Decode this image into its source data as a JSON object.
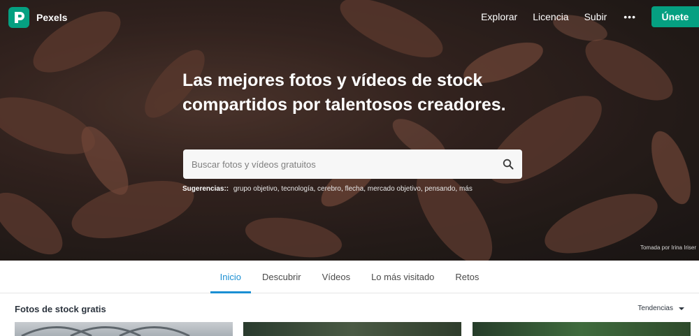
{
  "brand": {
    "name": "Pexels",
    "logo_icon": "pexels-logo-icon",
    "accent": "#05a081"
  },
  "nav": {
    "links": [
      "Explorar",
      "Licencia",
      "Subir"
    ],
    "more": "•••",
    "join": "Únete"
  },
  "hero": {
    "headline": "Las mejores fotos y vídeos de stock compartidos por talentosos creadores.",
    "search": {
      "placeholder": "Buscar fotos y vídeos gratuitos",
      "icon": "search-icon"
    },
    "suggestions_label": "Sugerencias::",
    "suggestions": [
      "grupo objetivo",
      "tecnología",
      "cerebro",
      "flecha",
      "mercado objetivo",
      "pensando",
      "más"
    ],
    "credit": "Tomada por Irina Iriser"
  },
  "tabs": [
    {
      "label": "Inicio",
      "active": true
    },
    {
      "label": "Descubrir",
      "active": false
    },
    {
      "label": "Vídeos",
      "active": false
    },
    {
      "label": "Lo más visitado",
      "active": false
    },
    {
      "label": "Retos",
      "active": false
    }
  ],
  "section": {
    "title": "Fotos de stock gratis",
    "sort": "Tendencias"
  },
  "colors": {
    "tab_active": "#1a8fd3",
    "hero_base": "#3d2a25"
  }
}
